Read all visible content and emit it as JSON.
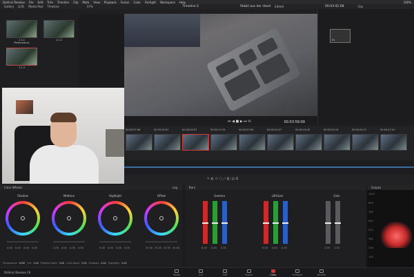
{
  "menubar": {
    "app": "DaVinci Resolve",
    "items": [
      "File",
      "Edit",
      "Trim",
      "Timeline",
      "Clip",
      "Mark",
      "View",
      "Playback",
      "Fusion",
      "Color",
      "Fairlight",
      "Workspace",
      "Help"
    ],
    "status": "100%"
  },
  "toolbar": {
    "left": [
      "Gallery",
      "LUTs",
      "Media Pool",
      "Timeline"
    ],
    "zoom": "37%",
    "timeline_name": "Timeline 2",
    "clip_name": "Stabil aus der Hand",
    "edited": "Edited",
    "timecode": "00:03:41:08",
    "clip_label": "Clip"
  },
  "gallery": {
    "stills": [
      {
        "label": "1.1.1\nPerformance",
        "selected": false
      },
      {
        "label": "1.1.2",
        "selected": false
      },
      {
        "label": "1.1.3",
        "selected": true
      }
    ]
  },
  "viewer": {
    "timecode": "00:03:59:09"
  },
  "nodes": {
    "node1": "01"
  },
  "clips": {
    "timecodes": [
      "00:03:57:46",
      "00:03:29:01",
      "00:00:04:57",
      "00:00:11:33",
      "00:03:57:09",
      "00:00:22:47",
      "00:00:34:30",
      "00:03:43:19",
      "00:00:54:11",
      "00:00:47:01"
    ],
    "selected_index": 2
  },
  "color_wheels": {
    "title": "Color Wheels",
    "mode": "Log",
    "wheels": [
      {
        "name": "Shadow",
        "values": [
          "0.00",
          "0.00",
          "0.00",
          "0.00"
        ]
      },
      {
        "name": "Midtone",
        "values": [
          "0.00",
          "0.00",
          "0.00",
          "0.00"
        ]
      },
      {
        "name": "Highlight",
        "values": [
          "0.00",
          "0.00",
          "0.00",
          "0.00"
        ]
      },
      {
        "name": "Offset",
        "values": [
          "25.00",
          "25.00",
          "25.00",
          "25.00"
        ]
      }
    ]
  },
  "params": [
    {
      "label": "Temperature",
      "value": "6700"
    },
    {
      "label": "Tint",
      "value": "0.00"
    },
    {
      "label": "Midtone Detail",
      "value": "0.00"
    },
    {
      "label": "Color Boost",
      "value": "0.00"
    },
    {
      "label": "Shadows",
      "value": "0.00"
    },
    {
      "label": "Highlights",
      "value": "0.00"
    }
  ],
  "bars_panel": {
    "title": "Bars",
    "groups": [
      {
        "name": "Gamma",
        "values": [
          "0.00",
          "0.00",
          "0.00"
        ]
      },
      {
        "name": "Lift/Gain",
        "values": [
          "0.00",
          "0.00",
          "0.00"
        ]
      },
      {
        "name": "Gain",
        "values": [
          "1.00",
          "1.00"
        ]
      }
    ]
  },
  "scope": {
    "title": "Scopes",
    "ticks": [
      "1023",
      "896",
      "768",
      "640",
      "512",
      "384",
      "256",
      "128"
    ]
  },
  "pages": {
    "app_name": "DaVinci Resolve 16",
    "items": [
      "Media",
      "Cut",
      "Edit",
      "Fusion",
      "Color",
      "Fairlight",
      "Deliver"
    ],
    "active": "Color"
  },
  "colors": {
    "accent_red": "#c53b3b",
    "timeline_blue": "#3a6ea3"
  }
}
